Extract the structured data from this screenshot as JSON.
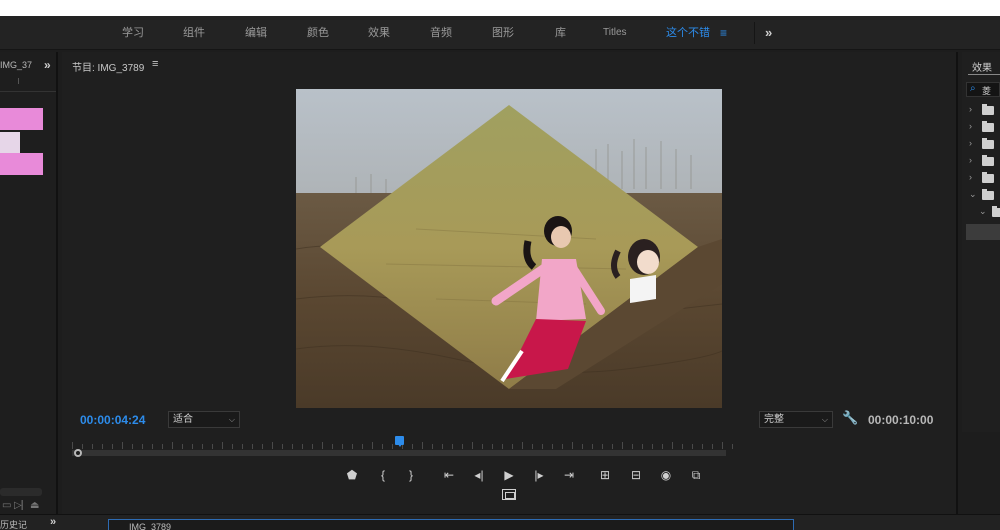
{
  "workspaces": {
    "tabs": [
      {
        "label": "学习",
        "active": false
      },
      {
        "label": "组件",
        "active": false
      },
      {
        "label": "编辑",
        "active": false
      },
      {
        "label": "颜色",
        "active": false
      },
      {
        "label": "效果",
        "active": false
      },
      {
        "label": "音频",
        "active": false
      },
      {
        "label": "图形",
        "active": false
      },
      {
        "label": "库",
        "active": false
      },
      {
        "label": "Titles",
        "active": false
      },
      {
        "label": "这个不错",
        "active": true
      }
    ],
    "menu_icon": "≡",
    "more_icon": "»"
  },
  "left_panel": {
    "title": "IMG_37",
    "more_icon": "»"
  },
  "program_monitor": {
    "title": "节目: IMG_3789",
    "menu_icon": "≡",
    "current_timecode": "00:00:04:24",
    "zoom_value": "适合",
    "quality_value": "完整",
    "duration_timecode": "00:00:10:00",
    "playhead_fraction": 0.5
  },
  "transport": {
    "add_marker": "⬟",
    "mark_in": "{",
    "mark_out": "}",
    "go_to_in": "⇤",
    "step_back": "◂|",
    "play": "▶",
    "step_forward": "|▸",
    "go_to_out": "⇥",
    "lift": "⊞",
    "extract": "⊟",
    "export_frame": "◉",
    "compare": "⧉"
  },
  "effects_panel": {
    "tab_label": "效果",
    "search_value": "菱"
  },
  "bottom": {
    "history_label": "历史记",
    "sequence_label": "IMG_3789",
    "sequence_menu": "≡"
  },
  "colors": {
    "accent": "#2d8ceb",
    "panel_bg": "#1f1f1f",
    "clip_pink": "#e88ad9"
  }
}
